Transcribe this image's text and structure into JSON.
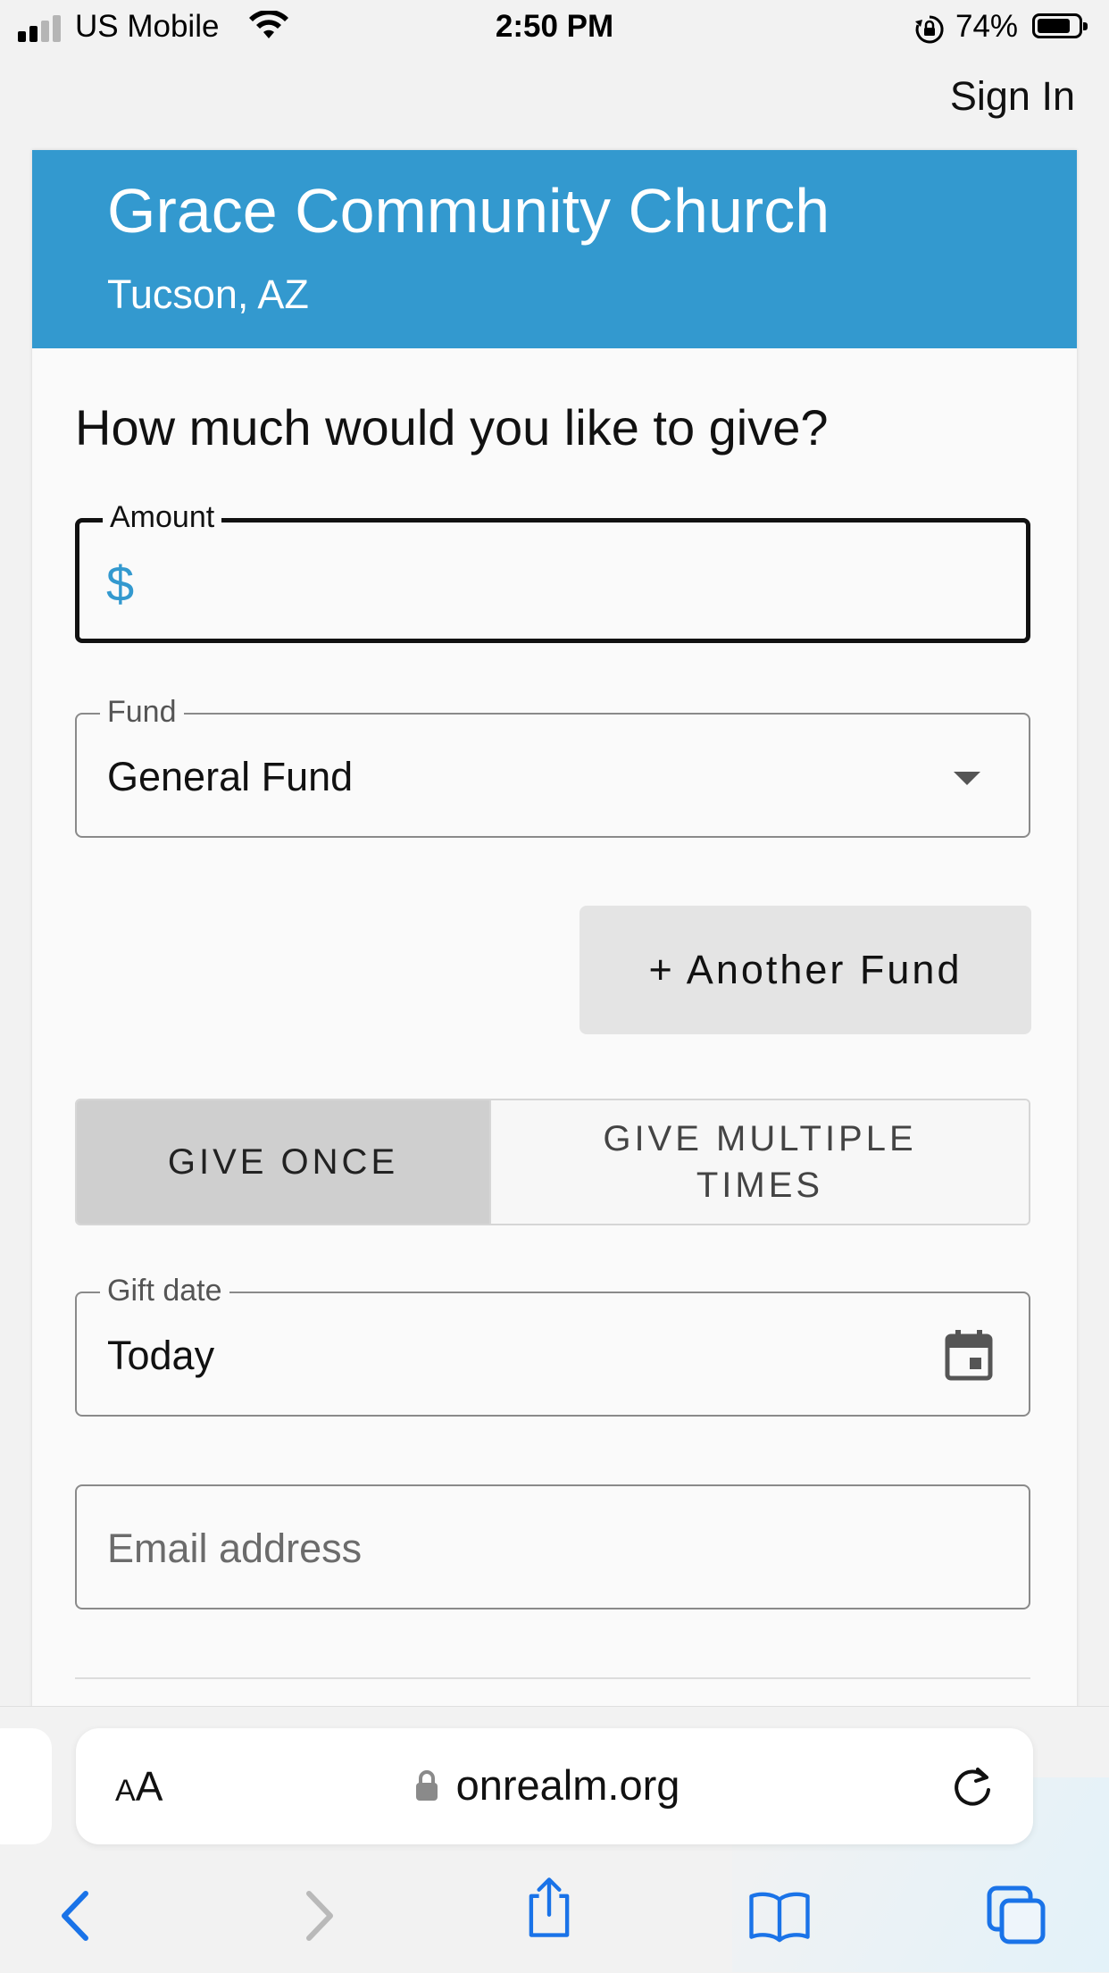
{
  "status_bar": {
    "carrier": "US  Mobile",
    "time": "2:50 PM",
    "battery": "74%",
    "battery_level": 0.74
  },
  "top_nav": {
    "sign_in": "Sign In"
  },
  "header": {
    "church_name": "Grace Community Church",
    "location": "Tucson, AZ",
    "color": "#3399cf"
  },
  "form": {
    "question": "How much would you like to give?",
    "amount": {
      "label": "Amount",
      "currency": "$",
      "value": ""
    },
    "fund": {
      "label": "Fund",
      "value": "General Fund"
    },
    "another_fund_button": "+ Another Fund",
    "frequency": {
      "give_once": "GIVE ONCE",
      "give_multiple": "GIVE MULTIPLE TIMES",
      "selected": "give_once"
    },
    "gift_date": {
      "label": "Gift date",
      "value": "Today"
    },
    "email": {
      "placeholder": "Email address"
    }
  },
  "browser": {
    "text_size": "AA",
    "url": "onrealm.org",
    "accent": "#1a73e8"
  },
  "icons": [
    "wifi-icon",
    "orientation-lock-icon",
    "battery-icon",
    "chevron-down-icon",
    "calendar-icon",
    "lock-icon",
    "reload-icon",
    "back-icon",
    "forward-icon",
    "share-icon",
    "bookmarks-icon",
    "tabs-icon"
  ]
}
